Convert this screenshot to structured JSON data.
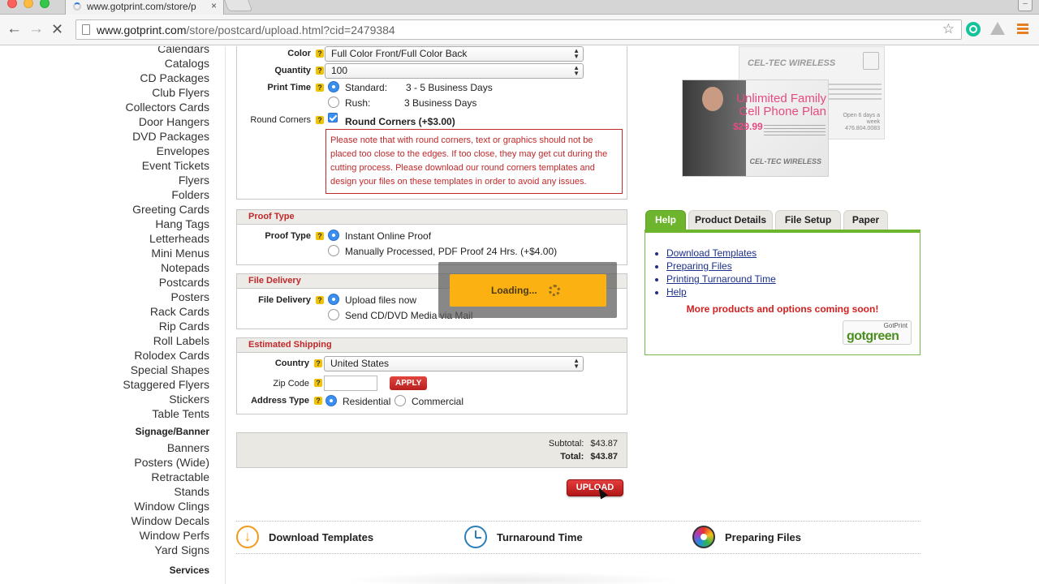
{
  "browser": {
    "tab_title": "www.gotprint.com/store/p",
    "tab_close": "×",
    "url_host": "www.gotprint.com",
    "url_path": "/store/postcard/upload.html?cid=2479384"
  },
  "sidebar": {
    "items_a": [
      "Calendars",
      "Catalogs",
      "CD Packages",
      "Club Flyers",
      "Collectors Cards",
      "Door Hangers",
      "DVD Packages",
      "Envelopes",
      "Event Tickets",
      "Flyers",
      "Folders",
      "Greeting Cards",
      "Hang Tags",
      "Letterheads",
      "Mini Menus",
      "Notepads",
      "Postcards",
      "Posters",
      "Rack Cards",
      "Rip Cards",
      "Roll Labels",
      "Rolodex Cards",
      "Special Shapes",
      "Staggered Flyers",
      "Stickers",
      "Table Tents"
    ],
    "group_signage": "Signage/Banner",
    "items_b": [
      "Banners",
      "Posters (Wide)",
      "Retractable",
      "Stands",
      "Window Clings",
      "Window Decals",
      "Window Perfs",
      "Yard Signs"
    ],
    "group_services": "Services"
  },
  "options": {
    "color_label": "Color",
    "color_value": "Full Color Front/Full Color Back",
    "quantity_label": "Quantity",
    "quantity_value": "100",
    "print_time_label": "Print Time",
    "standard_label": "Standard:",
    "standard_days": "3 - 5 Business Days",
    "rush_label": "Rush:",
    "rush_days": "3 Business Days",
    "round_corners_label": "Round Corners",
    "round_corners_option": "Round Corners (+$3.00)",
    "round_corners_note": "Please note that with round corners, text or graphics should not be placed too close to the edges. If too close, they may get cut during the cutting process. Please download our round corners templates and design your files on these templates in order to avoid any issues."
  },
  "proof": {
    "header": "Proof Type",
    "label": "Proof Type",
    "option1": "Instant Online Proof",
    "option2": "Manually Processed, PDF Proof 24 Hrs. (+$4.00)"
  },
  "delivery": {
    "header": "File Delivery",
    "label": "File Delivery",
    "option1": "Upload files now",
    "option2": "Send CD/DVD Media via Mail"
  },
  "shipping": {
    "header": "Estimated Shipping",
    "country_label": "Country",
    "country_value": "United States",
    "zip_label": "Zip Code",
    "apply_label": "APPLY",
    "address_label": "Address Type",
    "residential": "Residential",
    "commercial": "Commercial"
  },
  "totals": {
    "subtotal_label": "Subtotal:",
    "subtotal_value": "$43.87",
    "total_label": "Total:",
    "total_value": "$43.87"
  },
  "upload_label": "UPLOAD",
  "loading_text": "Loading...",
  "product_image": {
    "back_brand": "CEL-TEC WIRELESS",
    "front_headline": "Unlimited Family Cell Phone Plan",
    "front_price": "$29.99",
    "front_logo": "CEL-TEC WIRELESS",
    "back_small": "Open 6 days a week 476.804.0083"
  },
  "info_tabs": [
    "Help",
    "Product Details",
    "File Setup",
    "Paper"
  ],
  "help_links": [
    "Download Templates",
    "Preparing Files",
    "Printing Turnaround Time",
    "Help"
  ],
  "coming_soon": "More products and options coming soon!",
  "gotgreen": {
    "top": "GotPrint",
    "main": "gotgreen"
  },
  "bottom_features": [
    "Download Templates",
    "Turnaround Time",
    "Preparing Files"
  ],
  "colors": {
    "brand_red": "#c0282a",
    "tab_green": "#6cb52d",
    "loading_orange": "#fcb113",
    "link_blue": "#1b2f8c"
  }
}
